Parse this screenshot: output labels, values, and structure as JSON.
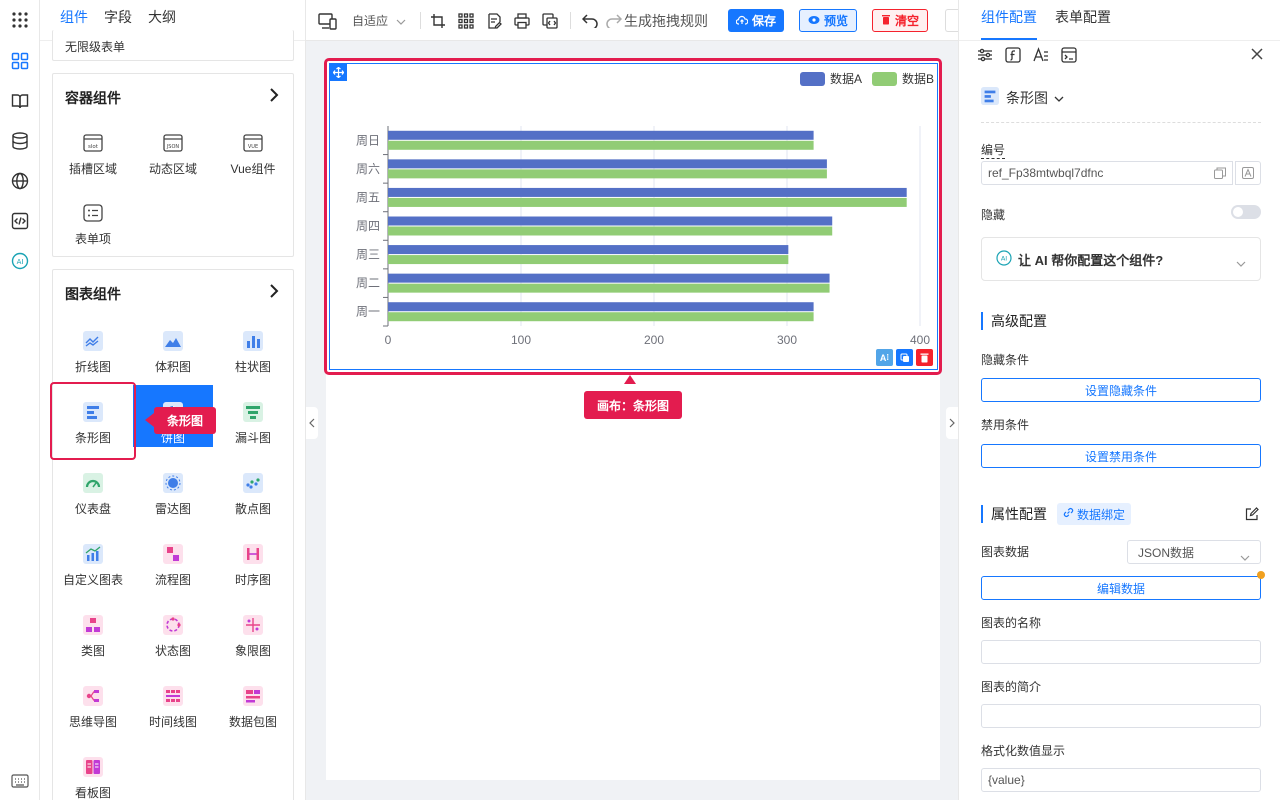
{
  "left_tabs": [
    "组件",
    "字段",
    "大纲"
  ],
  "top_cut_item": "无限级表单",
  "container_section": {
    "title": "容器组件",
    "items": [
      "插槽区域",
      "动态区域",
      "Vue组件",
      "表单项"
    ],
    "icon_texts": [
      "slot",
      "JSON",
      "VUE"
    ]
  },
  "chart_section": {
    "title": "图表组件",
    "items": [
      "折线图",
      "体积图",
      "柱状图",
      "条形图",
      "饼图",
      "漏斗图",
      "仪表盘",
      "雷达图",
      "散点图",
      "自定义图表",
      "流程图",
      "时序图",
      "类图",
      "状态图",
      "象限图",
      "思维导图",
      "时间线图",
      "数据包图",
      "看板图"
    ]
  },
  "left_tooltip": "条形图",
  "toolbar": {
    "adapt": "自适应",
    "gen_rule": "生成拖拽规则",
    "save": "保存",
    "preview": "预览",
    "clear": "清空"
  },
  "canvas_tooltip": "画布：条形图",
  "chart_data": {
    "type": "bar",
    "orientation": "horizontal",
    "categories": [
      "周一",
      "周二",
      "周三",
      "周四",
      "周五",
      "周六",
      "周日"
    ],
    "series": [
      {
        "name": "数据A",
        "values": [
          320,
          332,
          301,
          334,
          390,
          330,
          320
        ],
        "color": "#5470c6"
      },
      {
        "name": "数据B",
        "values": [
          320,
          332,
          301,
          334,
          390,
          330,
          320
        ],
        "color": "#91cc75"
      }
    ],
    "xlim": [
      0,
      400
    ],
    "xticks": [
      "0",
      "100",
      "200",
      "300",
      "400"
    ],
    "legend": "top-right",
    "grid": true
  },
  "right_tabs": [
    "组件配置",
    "表单配置"
  ],
  "component_name": "条形图",
  "fields": {
    "id_label": "编号",
    "id_value": "ref_Fp38mtwbql7dfnc",
    "hidden_label": "隐藏",
    "ai_prompt": "让 AI 帮你配置这个组件?",
    "advanced_title": "高级配置",
    "hide_cond_label": "隐藏条件",
    "hide_cond_btn": "设置隐藏条件",
    "disable_cond_label": "禁用条件",
    "disable_cond_btn": "设置禁用条件",
    "prop_title": "属性配置",
    "data_bind": "数据绑定",
    "chart_data_label": "图表数据",
    "chart_data_value": "JSON数据",
    "edit_data_btn": "编辑数据",
    "chart_name_label": "图表的名称",
    "chart_desc_label": "图表的简介",
    "format_label": "格式化数值显示",
    "format_value": "{value}"
  },
  "colors": {
    "accent": "#1677ff",
    "highlight": "#e31c4f",
    "danger": "#f5222d"
  }
}
